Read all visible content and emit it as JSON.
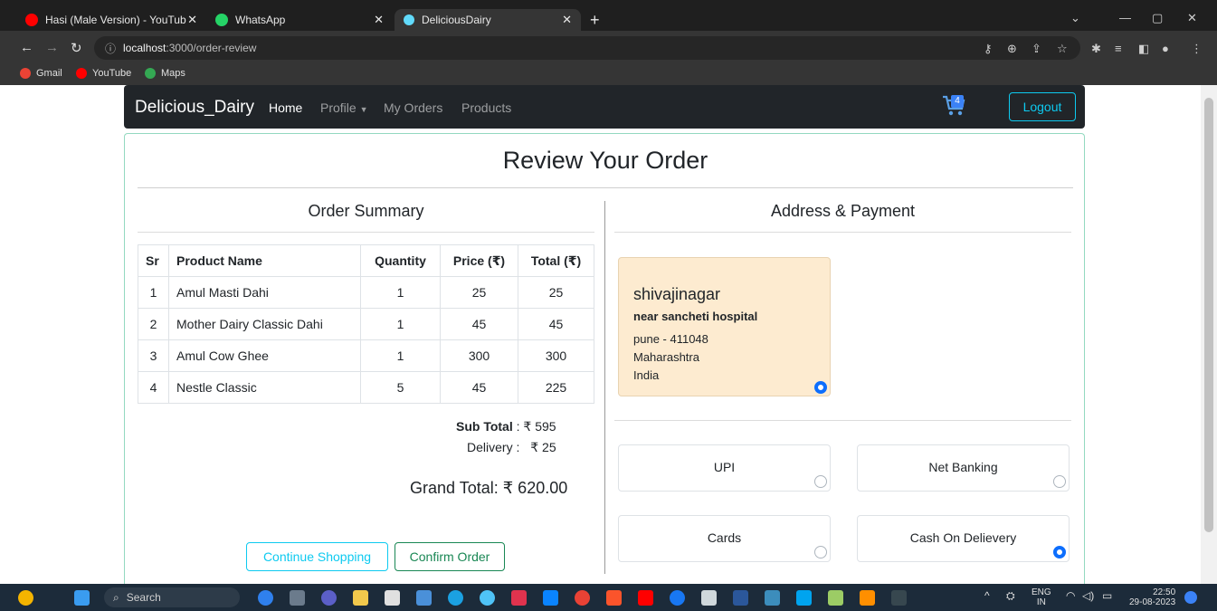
{
  "browser": {
    "tabs": [
      {
        "label": "Hasi (Male Version) - YouTub",
        "icon": "youtube-icon",
        "active": false
      },
      {
        "label": "WhatsApp",
        "icon": "whatsapp-icon",
        "active": false
      },
      {
        "label": "DeliciousDairy",
        "icon": "react-icon",
        "active": true
      }
    ],
    "url_host": "localhost",
    "url_path": ":3000/order-review",
    "bookmarks": [
      {
        "label": "Gmail",
        "color": "#ea4335"
      },
      {
        "label": "YouTube",
        "color": "#ff0000"
      },
      {
        "label": "Maps",
        "color": "#34a853"
      }
    ]
  },
  "navbar": {
    "brand": "Delicious_Dairy",
    "links": [
      "Home",
      "Profile",
      "My Orders",
      "Products"
    ],
    "cart_count": "4",
    "logout_label": "Logout"
  },
  "page": {
    "title": "Review Your Order",
    "summary_heading": "Order Summary",
    "address_heading": "Address & Payment"
  },
  "order_table": {
    "headers": [
      "Sr",
      "Product Name",
      "Quantity",
      "Price (₹)",
      "Total (₹)"
    ],
    "rows": [
      [
        "1",
        "Amul Masti Dahi",
        "1",
        "25",
        "25"
      ],
      [
        "2",
        "Mother Dairy Classic Dahi",
        "1",
        "45",
        "45"
      ],
      [
        "3",
        "Amul Cow Ghee",
        "1",
        "300",
        "300"
      ],
      [
        "4",
        "Nestle Classic",
        "5",
        "45",
        "225"
      ]
    ]
  },
  "totals": {
    "subtotal_label": "Sub Total",
    "subtotal_value": ": ₹ 595",
    "delivery_label": "Delivery :",
    "delivery_value": "₹ 25",
    "grand_total": "Grand Total: ₹ 620.00"
  },
  "buttons": {
    "continue": "Continue Shopping",
    "confirm": "Confirm Order"
  },
  "address": {
    "area": "shivajinagar",
    "landmark": "near sancheti hospital",
    "city_pin": "pune  -  411048",
    "state": "Maharashtra",
    "country": "India",
    "selected": true
  },
  "payment_options": [
    {
      "label": "UPI",
      "selected": false
    },
    {
      "label": "Net Banking",
      "selected": false
    },
    {
      "label": "Cards",
      "selected": false
    },
    {
      "label": "Cash On Delievery",
      "selected": true
    }
  ],
  "taskbar": {
    "search_placeholder": "Search",
    "lang_top": "ENG",
    "lang_bottom": "IN",
    "time": "22:50",
    "date": "29-08-2023"
  },
  "colors": {
    "navbar_bg": "#212529",
    "accent": "#0dcaf0",
    "confirm_border": "#198754",
    "card_border": "#93d9c0",
    "address_bg": "#fdebd0",
    "radio_on": "#0d6efd"
  }
}
